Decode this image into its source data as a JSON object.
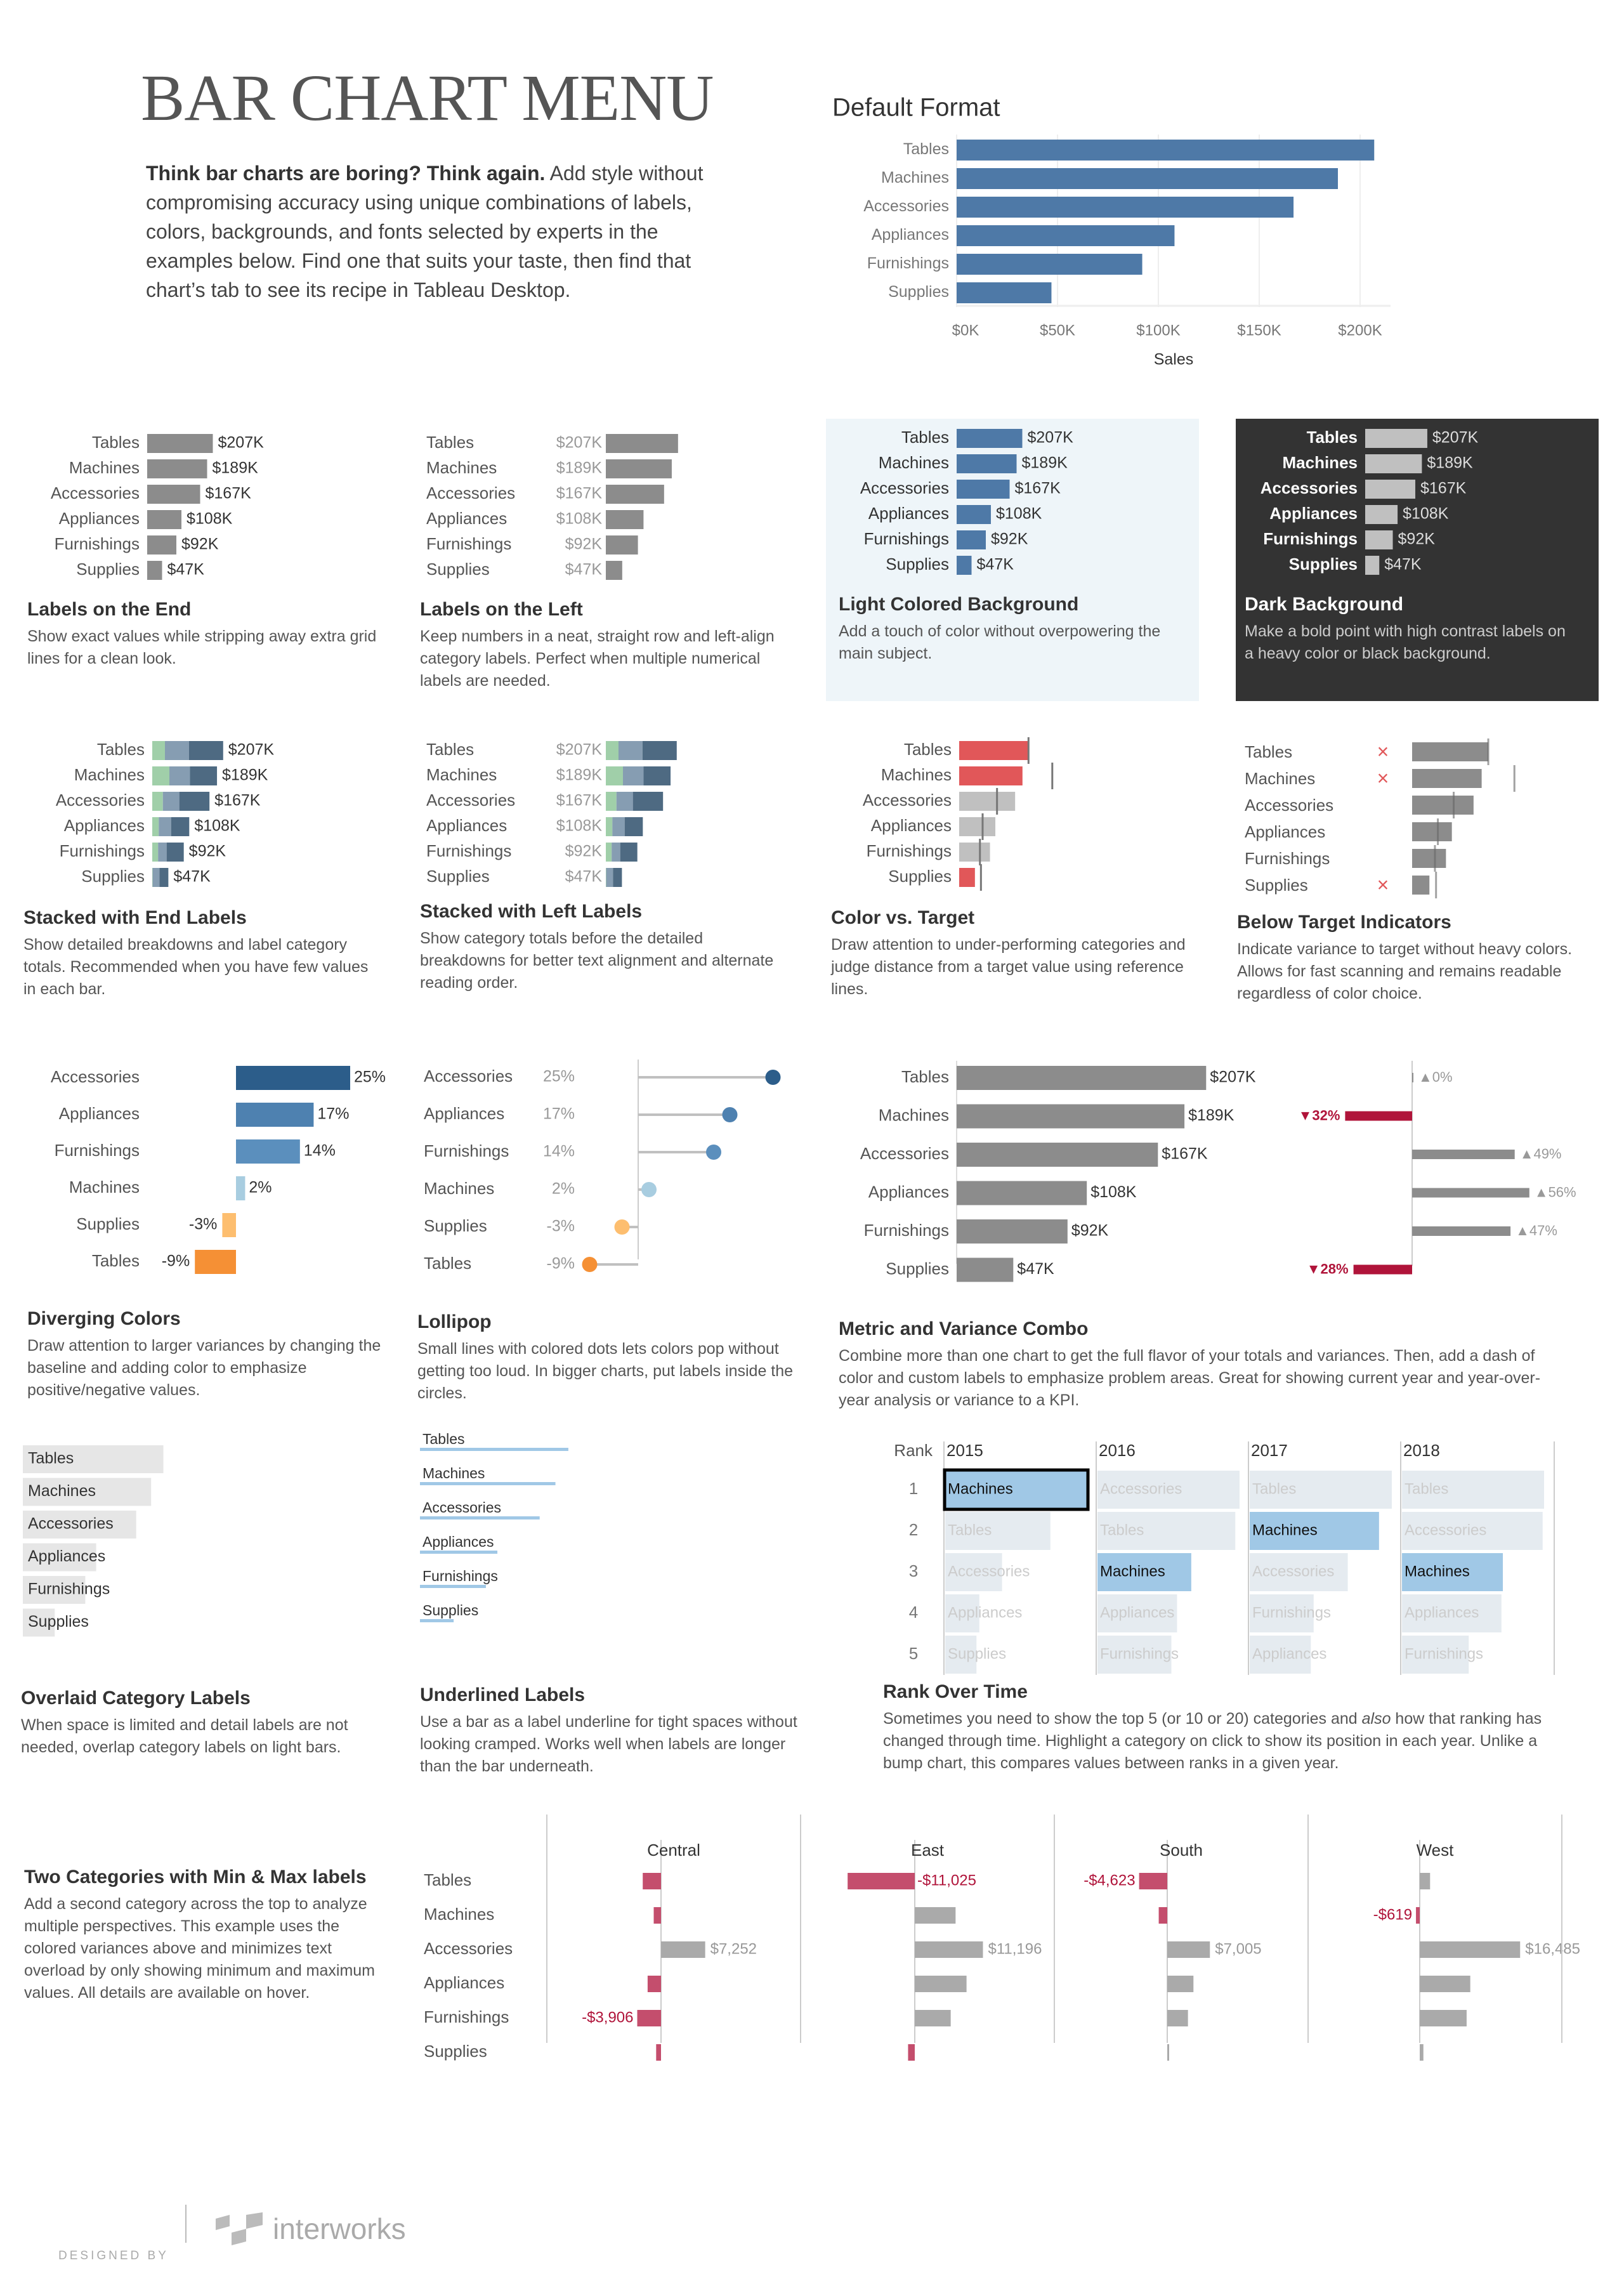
{
  "header": {
    "title": "BAR CHART MENU",
    "intro_bold": "Think bar charts are boring? Think again.",
    "intro_rest": " Add style without compromising accuracy using unique combinations of labels, colors, backgrounds, and fonts selected by experts in the examples below. Find one that suits your taste, then find that chart’s tab to see its recipe in Tableau Desktop."
  },
  "colors": {
    "default_blue": "#4e79a7",
    "gray_bar": "#8c8c8c",
    "light_gray_bar": "#c0c0c0",
    "red": "#e15759",
    "crimson": "#b0143a",
    "variance_red": "#c44e6d",
    "green": "#a0cfa9",
    "mid_blue_gray": "#869db2",
    "dark_blue_gray": "#4e6a82",
    "light_bg": "#eef5f9",
    "dark_bg": "#333333",
    "highlight_blue": "#a0c8e6",
    "faded_bar": "#e5ebf0",
    "overlay_bar": "#e6e6e6",
    "underline_blue": "#a0c8e6"
  },
  "categories": [
    "Tables",
    "Machines",
    "Accessories",
    "Appliances",
    "Furnishings",
    "Supplies"
  ],
  "sales_labels": [
    "$207K",
    "$189K",
    "$167K",
    "$108K",
    "$92K",
    "$47K"
  ],
  "chart_data": [
    {
      "id": "default_format",
      "type": "bar",
      "title": "Default Format",
      "categories": [
        "Tables",
        "Machines",
        "Accessories",
        "Appliances",
        "Furnishings",
        "Supplies"
      ],
      "values": [
        207,
        189,
        167,
        108,
        92,
        47
      ],
      "xlabel": "Sales",
      "ylabel": "",
      "xlim": [
        0,
        220
      ],
      "x_ticks": [
        "$0K",
        "$50K",
        "$100K",
        "$150K",
        "$200K"
      ],
      "x_tick_values": [
        0,
        50,
        100,
        150,
        200
      ],
      "grid": true
    },
    {
      "id": "labels_on_end",
      "type": "bar",
      "title": "Labels on the End",
      "description": "Show exact values while stripping away extra grid lines for a clean look.",
      "categories": [
        "Tables",
        "Machines",
        "Accessories",
        "Appliances",
        "Furnishings",
        "Supplies"
      ],
      "values": [
        207,
        189,
        167,
        108,
        92,
        47
      ],
      "labels": [
        "$207K",
        "$189K",
        "$167K",
        "$108K",
        "$92K",
        "$47K"
      ]
    },
    {
      "id": "labels_on_left",
      "type": "bar",
      "title": "Labels on the Left",
      "description": "Keep numbers in a neat, straight row and left-align category labels. Perfect when multiple numerical labels are needed.",
      "categories": [
        "Tables",
        "Machines",
        "Accessories",
        "Appliances",
        "Furnishings",
        "Supplies"
      ],
      "values": [
        207,
        189,
        167,
        108,
        92,
        47
      ],
      "labels": [
        "$207K",
        "$189K",
        "$167K",
        "$108K",
        "$92K",
        "$47K"
      ]
    },
    {
      "id": "light_background",
      "type": "bar",
      "title": "Light Colored Background",
      "description": "Add a touch of color without overpowering the main subject.",
      "categories": [
        "Tables",
        "Machines",
        "Accessories",
        "Appliances",
        "Furnishings",
        "Supplies"
      ],
      "values": [
        207,
        189,
        167,
        108,
        92,
        47
      ],
      "labels": [
        "$207K",
        "$189K",
        "$167K",
        "$108K",
        "$92K",
        "$47K"
      ]
    },
    {
      "id": "dark_background",
      "type": "bar",
      "title": "Dark Background",
      "description": "Make a bold point with high contrast labels on a heavy color or black background.",
      "categories": [
        "Tables",
        "Machines",
        "Accessories",
        "Appliances",
        "Furnishings",
        "Supplies"
      ],
      "values": [
        207,
        189,
        167,
        108,
        92,
        47
      ],
      "labels": [
        "$207K",
        "$189K",
        "$167K",
        "$108K",
        "$92K",
        "$47K"
      ]
    },
    {
      "id": "stacked_end",
      "type": "bar",
      "stacked": true,
      "title": "Stacked with End Labels",
      "description": "Show detailed breakdowns and label category totals. Recommended when you have few values in each bar.",
      "categories": [
        "Tables",
        "Machines",
        "Accessories",
        "Appliances",
        "Furnishings",
        "Supplies"
      ],
      "series": [
        {
          "name": "segment-1",
          "color": "#a0cfa9",
          "values": [
            37,
            50,
            31,
            19,
            17,
            1
          ]
        },
        {
          "name": "segment-2",
          "color": "#869db2",
          "values": [
            70,
            60,
            48,
            36,
            25,
            20
          ]
        },
        {
          "name": "segment-3",
          "color": "#4e6a82",
          "values": [
            100,
            79,
            88,
            53,
            50,
            26
          ]
        }
      ],
      "labels": [
        "$207K",
        "$189K",
        "$167K",
        "$108K",
        "$92K",
        "$47K"
      ]
    },
    {
      "id": "stacked_left",
      "type": "bar",
      "stacked": true,
      "title": "Stacked with Left Labels",
      "description": "Show category totals before the detailed breakdowns for better text alignment and alternate reading order.",
      "categories": [
        "Tables",
        "Machines",
        "Accessories",
        "Appliances",
        "Furnishings",
        "Supplies"
      ],
      "series": [
        {
          "name": "segment-1",
          "color": "#a0cfa9",
          "values": [
            37,
            50,
            31,
            19,
            17,
            1
          ]
        },
        {
          "name": "segment-2",
          "color": "#869db2",
          "values": [
            70,
            60,
            48,
            36,
            25,
            20
          ]
        },
        {
          "name": "segment-3",
          "color": "#4e6a82",
          "values": [
            100,
            79,
            88,
            53,
            50,
            26
          ]
        }
      ],
      "labels": [
        "$207K",
        "$189K",
        "$167K",
        "$108K",
        "$92K",
        "$47K"
      ]
    },
    {
      "id": "color_vs_target",
      "type": "bar",
      "title": "Color vs. Target",
      "description": "Draw attention to under-performing categories and judge distance from a target value using reference lines.",
      "categories": [
        "Tables",
        "Machines",
        "Accessories",
        "Appliances",
        "Furnishings",
        "Supplies"
      ],
      "values": [
        207,
        189,
        167,
        108,
        92,
        47
      ],
      "targets": [
        207,
        278,
        113,
        70,
        62,
        65
      ],
      "below_target": [
        true,
        true,
        false,
        false,
        false,
        true
      ]
    },
    {
      "id": "below_target_indicators",
      "type": "bar",
      "title": "Below Target Indicators",
      "description": "Indicate variance to target without heavy colors. Allows for fast scanning and remains readable regardless of color choice.",
      "categories": [
        "Tables",
        "Machines",
        "Accessories",
        "Appliances",
        "Furnishings",
        "Supplies"
      ],
      "values": [
        207,
        189,
        167,
        108,
        92,
        47
      ],
      "targets": [
        207,
        278,
        113,
        70,
        62,
        65
      ],
      "below_target": [
        true,
        true,
        false,
        false,
        false,
        true
      ],
      "indicator": "×"
    },
    {
      "id": "diverging_colors",
      "type": "bar",
      "title": "Diverging Colors",
      "description": "Draw attention to larger variances by changing the baseline and adding color to emphasize positive/negative values.",
      "categories": [
        "Accessories",
        "Appliances",
        "Furnishings",
        "Machines",
        "Supplies",
        "Tables"
      ],
      "values": [
        25,
        17,
        14,
        2,
        -3,
        -9
      ],
      "labels": [
        "25%",
        "17%",
        "14%",
        "2%",
        "-3%",
        "-9%"
      ],
      "colors": [
        "#2c5d8a",
        "#4e81b0",
        "#5b8fbd",
        "#a8cde0",
        "#fdbe6f",
        "#f59035"
      ]
    },
    {
      "id": "lollipop",
      "type": "scatter",
      "title": "Lollipop",
      "description": "Small lines with colored dots lets colors pop without getting too loud. In bigger charts, put labels inside the circles.",
      "categories": [
        "Accessories",
        "Appliances",
        "Furnishings",
        "Machines",
        "Supplies",
        "Tables"
      ],
      "values": [
        25,
        17,
        14,
        2,
        -3,
        -9
      ],
      "labels": [
        "25%",
        "17%",
        "14%",
        "2%",
        "-3%",
        "-9%"
      ],
      "colors": [
        "#2c5d8a",
        "#4e81b0",
        "#5b8fbd",
        "#a8cde0",
        "#fdbe6f",
        "#f59035"
      ]
    },
    {
      "id": "metric_variance",
      "type": "bar",
      "title": "Metric and Variance Combo",
      "description": "Combine more than one chart to get the full flavor of your totals and variances. Then, add a dash of color and custom labels to emphasize problem areas. Great for showing current year and year-over-year analysis or variance to a KPI.",
      "categories": [
        "Tables",
        "Machines",
        "Accessories",
        "Appliances",
        "Furnishings",
        "Supplies"
      ],
      "values": [
        207,
        189,
        167,
        108,
        92,
        47
      ],
      "labels": [
        "$207K",
        "$189K",
        "$167K",
        "$108K",
        "$92K",
        "$47K"
      ],
      "variance": [
        0,
        -32,
        49,
        56,
        47,
        -28
      ],
      "variance_labels": [
        "▲0%",
        "▼32%",
        "▲49%",
        "▲56%",
        "▲47%",
        "▼28%"
      ]
    },
    {
      "id": "overlaid_labels",
      "type": "bar",
      "title": "Overlaid Category Labels",
      "description": "When space is limited and detail labels are not needed, overlap category labels on light bars.",
      "categories": [
        "Tables",
        "Machines",
        "Accessories",
        "Appliances",
        "Furnishings",
        "Supplies"
      ],
      "values": [
        207,
        189,
        167,
        108,
        92,
        47
      ]
    },
    {
      "id": "underlined_labels",
      "type": "bar",
      "title": "Underlined Labels",
      "description": "Use a bar as a label underline for tight spaces without looking cramped. Works well when labels are longer than the bar underneath.",
      "categories": [
        "Tables",
        "Machines",
        "Accessories",
        "Appliances",
        "Furnishings",
        "Supplies"
      ],
      "values": [
        207,
        189,
        167,
        108,
        92,
        47
      ]
    },
    {
      "id": "rank_over_time",
      "type": "bar",
      "title": "Rank Over Time",
      "description_pre": "Sometimes you need to show the top 5 (or 10 or 20) categories and ",
      "description_em": "also",
      "description_post": " how that ranking has changed through time. Highlight a category on click to show its position in each year. Unlike a bump chart, this compares values between ranks in a given year.",
      "rank_header": "Rank",
      "ranks": [
        "1",
        "2",
        "3",
        "4",
        "5"
      ],
      "highlight": "Machines",
      "years": [
        {
          "year": "2015",
          "items": [
            "Machines",
            "Tables",
            "Accessories",
            "Appliances",
            "Supplies"
          ],
          "values": [
            100,
            74,
            40,
            24,
            22
          ]
        },
        {
          "year": "2016",
          "items": [
            "Accessories",
            "Tables",
            "Machines",
            "Appliances",
            "Furnishings"
          ],
          "values": [
            100,
            97,
            66,
            56,
            52
          ]
        },
        {
          "year": "2017",
          "items": [
            "Tables",
            "Machines",
            "Accessories",
            "Furnishings",
            "Appliances"
          ],
          "values": [
            100,
            91,
            69,
            45,
            43
          ]
        },
        {
          "year": "2018",
          "items": [
            "Tables",
            "Accessories",
            "Machines",
            "Appliances",
            "Furnishings"
          ],
          "values": [
            100,
            99,
            71,
            70,
            47
          ]
        }
      ]
    },
    {
      "id": "two_categories",
      "type": "bar",
      "title": "Two Categories with Min & Max labels",
      "description": "Add a second category across the top to analyze multiple perspectives. This example uses the colored variances above and minimizes text overload by only showing minimum and maximum values. All details are available on hover.",
      "categories": [
        "Tables",
        "Machines",
        "Accessories",
        "Appliances",
        "Furnishings",
        "Supplies"
      ],
      "regions": [
        {
          "name": "Central",
          "values": [
            -3000,
            -1200,
            7252,
            -2200,
            -3906,
            -800
          ],
          "labels": [
            "",
            "",
            "$7,252",
            "",
            "-$3,906",
            ""
          ]
        },
        {
          "name": "East",
          "values": [
            -11025,
            6700,
            11196,
            8500,
            5900,
            -1100
          ],
          "labels": [
            "-$11,025",
            "",
            "$11,196",
            "",
            "",
            ""
          ]
        },
        {
          "name": "South",
          "values": [
            -4623,
            -1400,
            7005,
            4300,
            3400,
            200
          ],
          "labels": [
            "-$4,623",
            "",
            "$7,005",
            "",
            "",
            ""
          ]
        },
        {
          "name": "West",
          "values": [
            1700,
            -619,
            16485,
            8300,
            7700,
            600
          ],
          "labels": [
            "",
            "-$619",
            "$16,485",
            "",
            "",
            ""
          ]
        }
      ]
    }
  ],
  "footer": {
    "designed_by": "DESIGNED BY",
    "logo_text": "interworks"
  }
}
